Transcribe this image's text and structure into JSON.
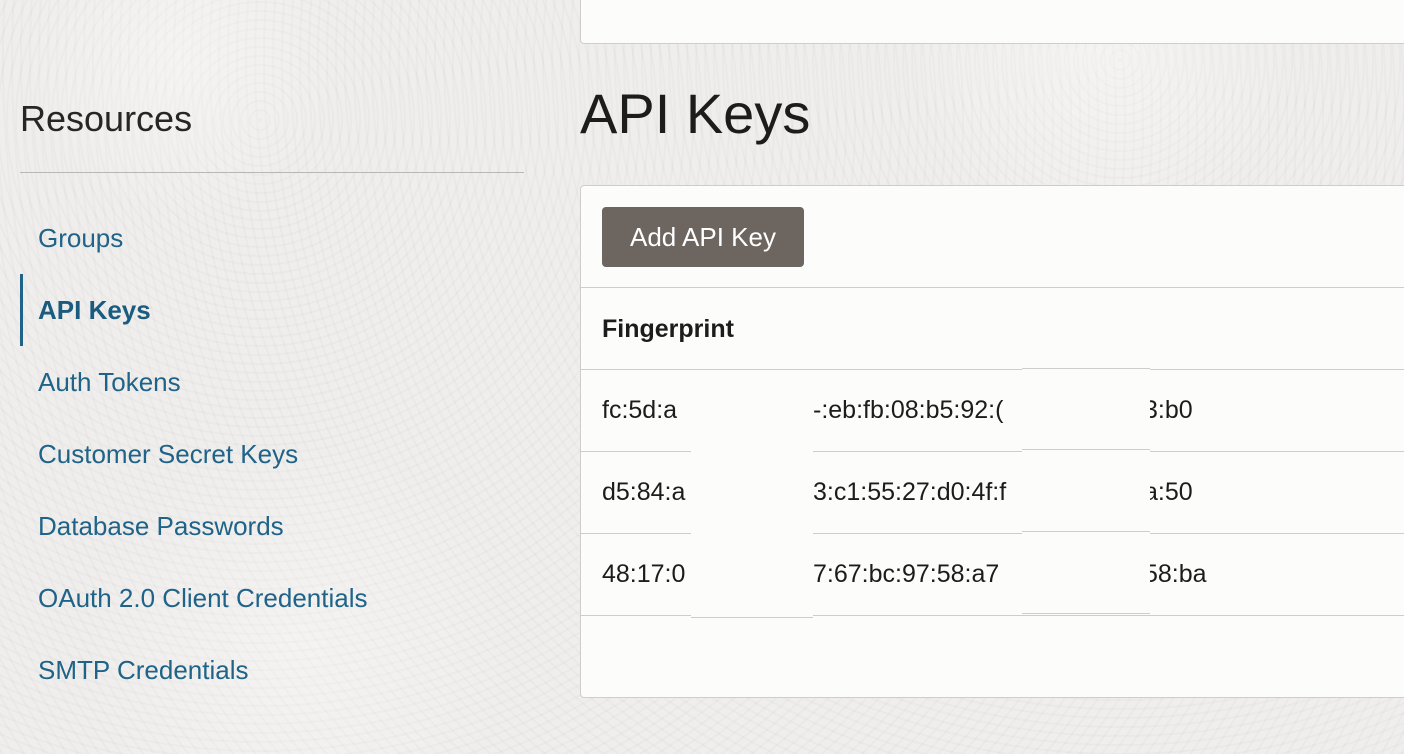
{
  "sidebar": {
    "title": "Resources",
    "items": [
      {
        "label": "Groups",
        "active": false
      },
      {
        "label": "API Keys",
        "active": true
      },
      {
        "label": "Auth Tokens",
        "active": false
      },
      {
        "label": "Customer Secret Keys",
        "active": false
      },
      {
        "label": "Database Passwords",
        "active": false
      },
      {
        "label": "OAuth 2.0 Client Credentials",
        "active": false
      },
      {
        "label": "SMTP Credentials",
        "active": false
      }
    ]
  },
  "main": {
    "title": "API Keys",
    "add_button_label": "Add API Key",
    "table": {
      "columns": [
        "Fingerprint"
      ],
      "rows": [
        {
          "part1": "fc:5d:a",
          "part2": "-:eb:fb:08:b5:92:(",
          "part3": "3:b0"
        },
        {
          "part1": "d5:84:a",
          "part2": "3:c1:55:27:d0:4f:f",
          "part3": "a:50"
        },
        {
          "part1": "48:17:0",
          "part2": "7:67:bc:97:58:a7",
          "part3": "58:ba"
        }
      ]
    }
  },
  "colors": {
    "link": "#1f6389",
    "button_bg": "#6d6560",
    "background": "#efeeec"
  }
}
